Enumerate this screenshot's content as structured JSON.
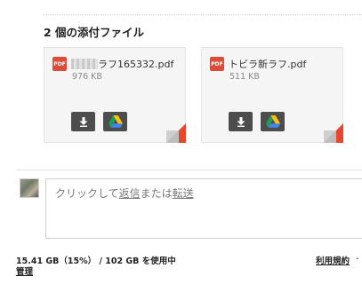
{
  "attachments": {
    "heading": "2 個の添付ファイル",
    "files": [
      {
        "name": "ラフ165332.pdf",
        "name_redacted": true,
        "size": "976 KB",
        "type_label": "PDF"
      },
      {
        "name": "トビラ新ラフ.pdf",
        "name_redacted": false,
        "size": "511 KB",
        "type_label": "PDF"
      }
    ]
  },
  "reply": {
    "prefix": "クリックして",
    "reply_link": "返信",
    "middle": "または",
    "forward_link": "転送"
  },
  "footer": {
    "storage": "15.41 GB（15%） / 102 GB を使用中",
    "manage": "管理",
    "terms": "利用規約",
    "terms_sep": "-"
  },
  "colors": {
    "pdf_red": "#dd4b39",
    "button_bg": "#4d4d4d",
    "fold_red": "#e8472f"
  },
  "icons": [
    "pdf-icon",
    "download-icon",
    "google-drive-icon"
  ]
}
